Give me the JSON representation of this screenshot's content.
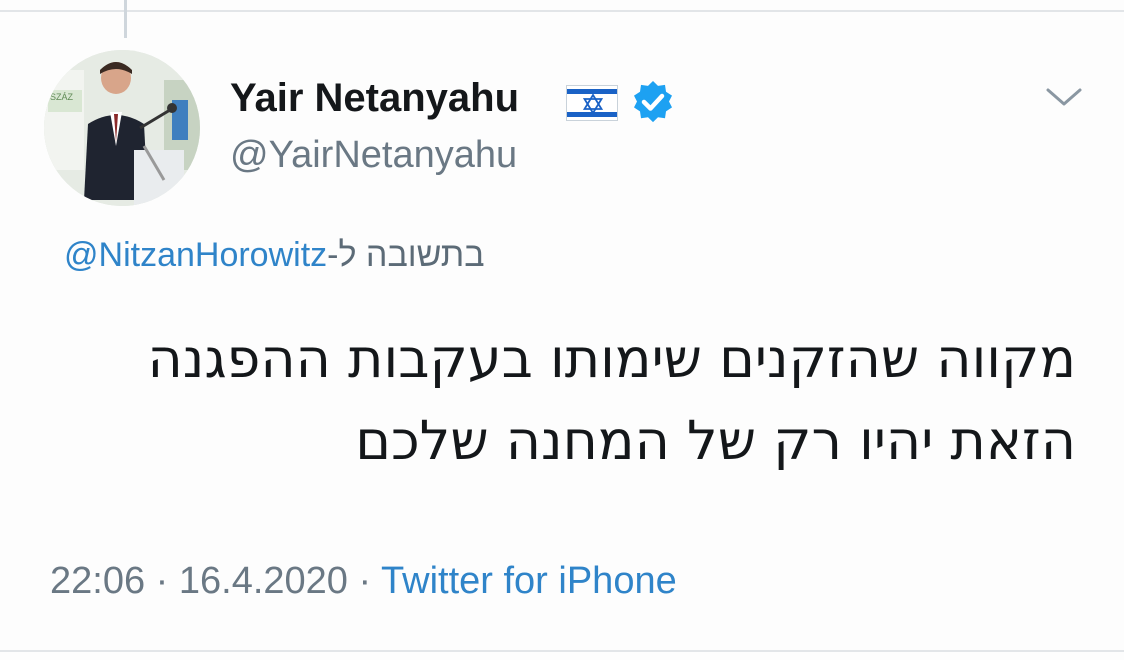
{
  "tweet": {
    "display_name": "Yair Netanyahu",
    "handle": "@YairNetanyahu",
    "reply_prefix": "בתשובה ל-",
    "reply_mention": "@NitzanHorowitz",
    "text_line1": "מקווה שהזקנים שימותו בעקבות ההפגנה",
    "text_line2": "הזאת יהיו רק של המחנה שלכם",
    "time": "22:06",
    "separator": "·",
    "date": "16.4.2020",
    "source": "Twitter for iPhone",
    "avatar_sign_text": "SZÁZ",
    "verified_badge_color": "#1da1f2",
    "link_color": "#2f84c9",
    "flag_icon": "israel-flag-icon"
  }
}
